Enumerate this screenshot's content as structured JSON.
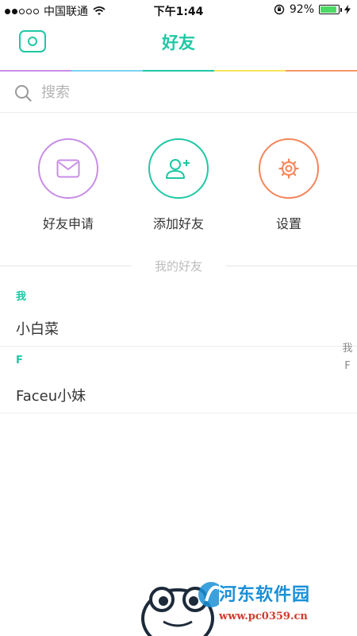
{
  "status_bar": {
    "carrier": "中国联通",
    "time": "下午1:44",
    "battery_percent_text": "92%",
    "battery_level": 0.92,
    "signal_bars_filled": 2,
    "signal_bars_total": 5
  },
  "navbar": {
    "title": "好友",
    "camera_icon": "camera-icon",
    "accent_color": "#1fc8a4",
    "rainbow_colors": [
      "#c98de8",
      "#7ad3f0",
      "#1fc8a4",
      "#f7e45a",
      "#f59a6b"
    ]
  },
  "search": {
    "placeholder": "搜索",
    "icon": "search-icon"
  },
  "actions": [
    {
      "label": "好友申请",
      "icon": "mail-icon",
      "color": "#c98de8"
    },
    {
      "label": "添加好友",
      "icon": "add-user-icon",
      "color": "#1fc8a4"
    },
    {
      "label": "设置",
      "icon": "gear-icon",
      "color": "#f5855a"
    }
  ],
  "friends": {
    "section_title": "我的好友",
    "groups": [
      {
        "header": "我",
        "items": [
          "小白菜"
        ]
      },
      {
        "header": "F",
        "items": [
          "Faceu小妹"
        ]
      }
    ],
    "index": [
      "我",
      "F"
    ]
  },
  "watermark": {
    "name": "河东软件园",
    "url": "www.pc0359.cn"
  }
}
